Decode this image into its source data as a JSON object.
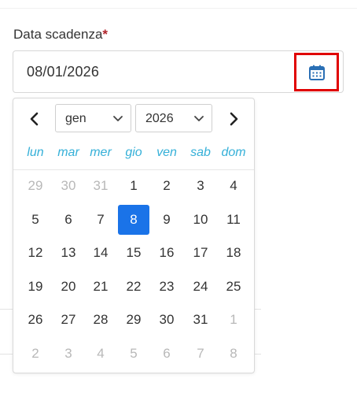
{
  "field": {
    "label": "Data scadenza",
    "required_mark": "*",
    "value": "08/01/2026"
  },
  "icons": {
    "calendar": "calendar-icon",
    "prev": "chevron-left-icon",
    "next": "chevron-right-icon",
    "dropdown": "chevron-down-icon"
  },
  "datepicker": {
    "month_select": "gen",
    "year_select": "2026",
    "weekdays": [
      "lun",
      "mar",
      "mer",
      "gio",
      "ven",
      "sab",
      "dom"
    ],
    "weeks": [
      [
        {
          "d": "29",
          "muted": true
        },
        {
          "d": "30",
          "muted": true
        },
        {
          "d": "31",
          "muted": true
        },
        {
          "d": "1"
        },
        {
          "d": "2"
        },
        {
          "d": "3"
        },
        {
          "d": "4"
        }
      ],
      [
        {
          "d": "5"
        },
        {
          "d": "6"
        },
        {
          "d": "7"
        },
        {
          "d": "8",
          "selected": true
        },
        {
          "d": "9"
        },
        {
          "d": "10"
        },
        {
          "d": "11"
        }
      ],
      [
        {
          "d": "12"
        },
        {
          "d": "13"
        },
        {
          "d": "14"
        },
        {
          "d": "15"
        },
        {
          "d": "16"
        },
        {
          "d": "17"
        },
        {
          "d": "18"
        }
      ],
      [
        {
          "d": "19"
        },
        {
          "d": "20"
        },
        {
          "d": "21"
        },
        {
          "d": "22"
        },
        {
          "d": "23"
        },
        {
          "d": "24"
        },
        {
          "d": "25"
        }
      ],
      [
        {
          "d": "26"
        },
        {
          "d": "27"
        },
        {
          "d": "28"
        },
        {
          "d": "29"
        },
        {
          "d": "30"
        },
        {
          "d": "31"
        },
        {
          "d": "1",
          "muted": true
        }
      ],
      [
        {
          "d": "2",
          "muted": true
        },
        {
          "d": "3",
          "muted": true
        },
        {
          "d": "4",
          "muted": true
        },
        {
          "d": "5",
          "muted": true
        },
        {
          "d": "6",
          "muted": true
        },
        {
          "d": "7",
          "muted": true
        },
        {
          "d": "8",
          "muted": true
        }
      ]
    ]
  },
  "colors": {
    "required": "#b0232a",
    "highlight_border": "#e00000",
    "calendar_icon": "#2a6fb5",
    "weekday": "#35b0d8",
    "selected_day": "#1a73e8",
    "muted_day": "#b8b8b8"
  }
}
